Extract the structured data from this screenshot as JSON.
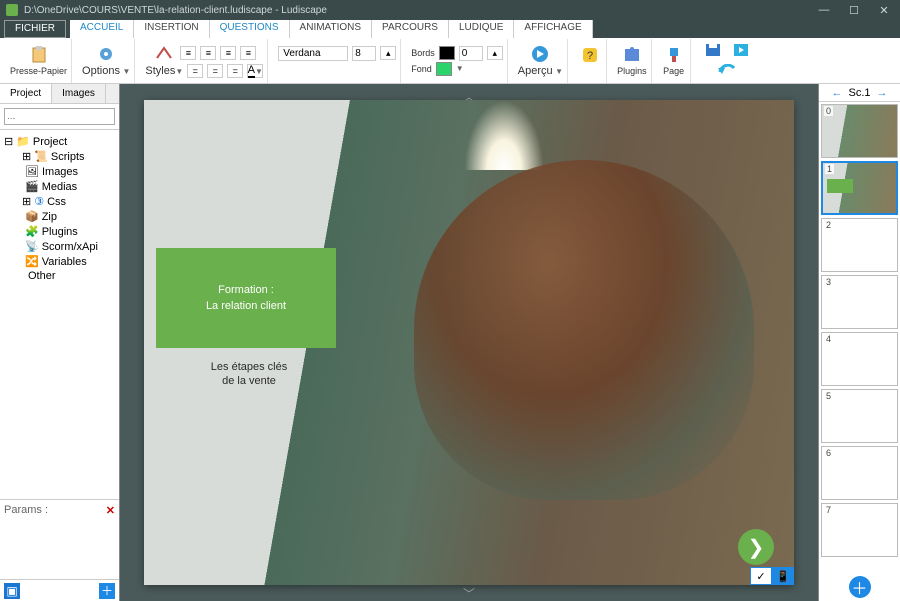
{
  "window": {
    "title": "D:\\OneDrive\\COURS\\VENTE\\la-relation-client.ludiscape - Ludiscape"
  },
  "menu": {
    "file": "FICHIER",
    "tabs": [
      "ACCUEIL",
      "INSERTION",
      "QUESTIONS",
      "ANIMATIONS",
      "PARCOURS",
      "LUDIQUE",
      "AFFICHAGE"
    ]
  },
  "ribbon": {
    "clipboard": "Presse-Papier",
    "options": "Options",
    "styles": "Styles",
    "font_name": "Verdana",
    "font_size": "8",
    "borders_label": "Bords",
    "borders_value": "0",
    "fill_label": "Fond",
    "preview": "Aperçu",
    "plugins": "Plugins",
    "page": "Page",
    "border_color": "#000000",
    "fill_color": "#2bd46a",
    "text_color": "#000000"
  },
  "left": {
    "tab_project": "Project",
    "tab_images": "Images",
    "search_placeholder": "...",
    "tree_root": "Project",
    "tree": [
      "Scripts",
      "Images",
      "Medias",
      "Css",
      "Zip",
      "Plugins",
      "Scorm/xApi",
      "Variables",
      "Other"
    ],
    "params_label": "Params :"
  },
  "slide": {
    "green_line1": "Formation :",
    "green_line2": "La relation client",
    "subtitle_line1": "Les étapes clés",
    "subtitle_line2": "de la vente"
  },
  "right": {
    "scene": "Sc.1",
    "thumbs": [
      "0",
      "1",
      "2",
      "3",
      "4",
      "5",
      "6",
      "7"
    ]
  }
}
